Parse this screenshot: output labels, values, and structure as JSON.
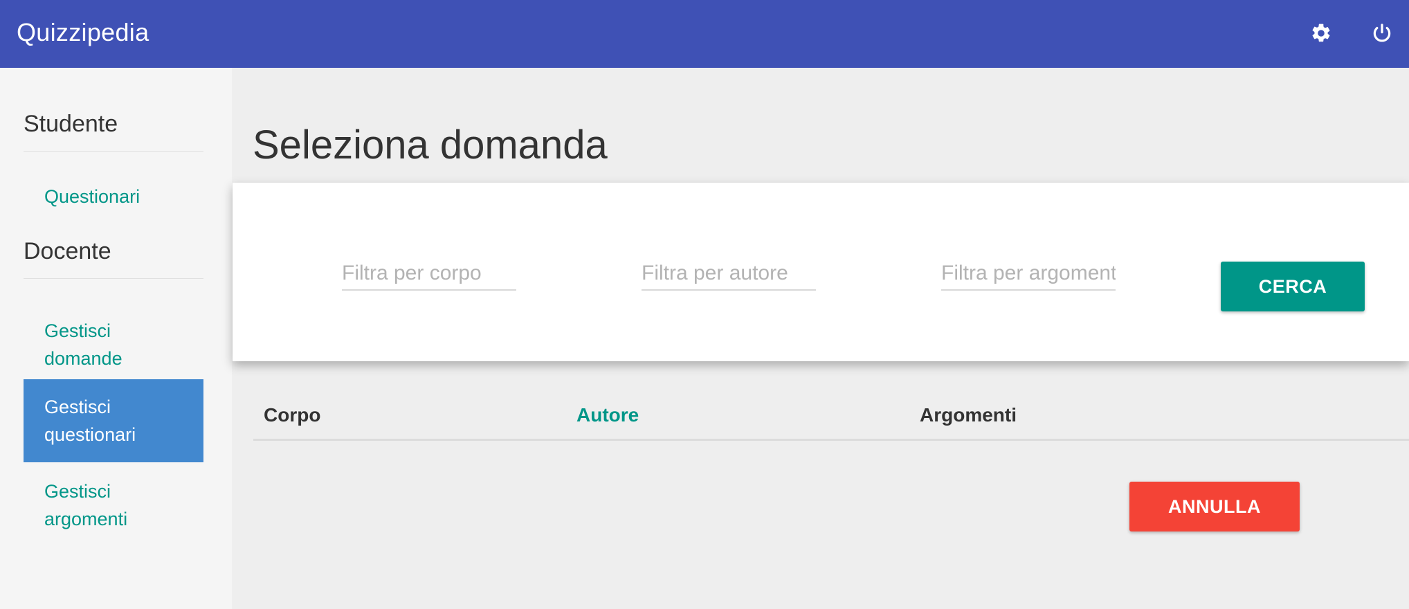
{
  "app": {
    "title": "Quizzipedia"
  },
  "topbar": {
    "settings_icon": "gear-icon",
    "logout_icon": "power-icon"
  },
  "sidebar": {
    "sections": [
      {
        "title": "Studente",
        "items": [
          {
            "label": "Questionari",
            "active": false
          }
        ]
      },
      {
        "title": "Docente",
        "items": [
          {
            "label": "Gestisci domande",
            "active": false
          },
          {
            "label": "Gestisci questionari",
            "active": true
          },
          {
            "label": "Gestisci argomenti",
            "active": false
          }
        ]
      }
    ]
  },
  "main": {
    "title": "Seleziona domanda",
    "filters": {
      "body_placeholder": "Filtra per corpo",
      "author_placeholder": "Filtra per autore",
      "topic_placeholder": "Filtra per argomenti",
      "search_label": "CERCA"
    },
    "table": {
      "columns": [
        "Corpo",
        "Autore",
        "Argomenti"
      ]
    },
    "cancel_label": "ANNULLA"
  },
  "colors": {
    "primary": "#3f51b5",
    "accent": "#009688",
    "active": "#4288cf",
    "danger": "#f44336"
  }
}
